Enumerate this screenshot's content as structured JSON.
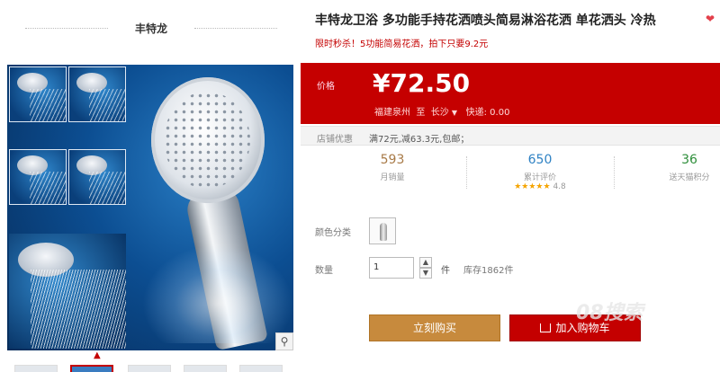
{
  "store": {
    "name": "丰特龙"
  },
  "product": {
    "title": "丰特龙卫浴 多功能手持花洒喷头简易淋浴花洒 单花洒头 冷热",
    "subtitle": "限时秒杀！5功能简易花洒，拍下只要9.2元"
  },
  "price": {
    "label": "价格",
    "value": "¥72.50",
    "origin": "福建泉州",
    "to": "至",
    "dest": "长沙",
    "dest_arrow": "▼",
    "shipping_label": "快递:",
    "shipping_value": "0.00"
  },
  "promo": {
    "label": "店铺优惠",
    "text": "满72元,减63.3元,包邮；"
  },
  "stats": {
    "sales": {
      "value": "593",
      "label": "月销量"
    },
    "reviews": {
      "value": "650",
      "label": "累计评价",
      "stars": "★★★★★",
      "score": "4.8"
    },
    "points": {
      "value": "36",
      "label": "送天猫积分"
    }
  },
  "options": {
    "color_label": "颜色分类",
    "qty_label": "数量",
    "qty_value": "1",
    "qty_up": "▲",
    "qty_down": "▼",
    "qty_unit": "件",
    "stock": "库存1862件"
  },
  "buttons": {
    "buy": "立刻购买",
    "cart": "加入购物车"
  },
  "watermark": "08搜索",
  "icons": {
    "zoom": "magnifier-icon",
    "fav": "heart-icon",
    "cart": "cart-icon"
  },
  "colors": {
    "brand_red": "#c40000",
    "buy_orange": "#c78a3d",
    "sales_color": "#a87a47",
    "reviews_color": "#2f82c4",
    "points_color": "#2f8f3b"
  }
}
